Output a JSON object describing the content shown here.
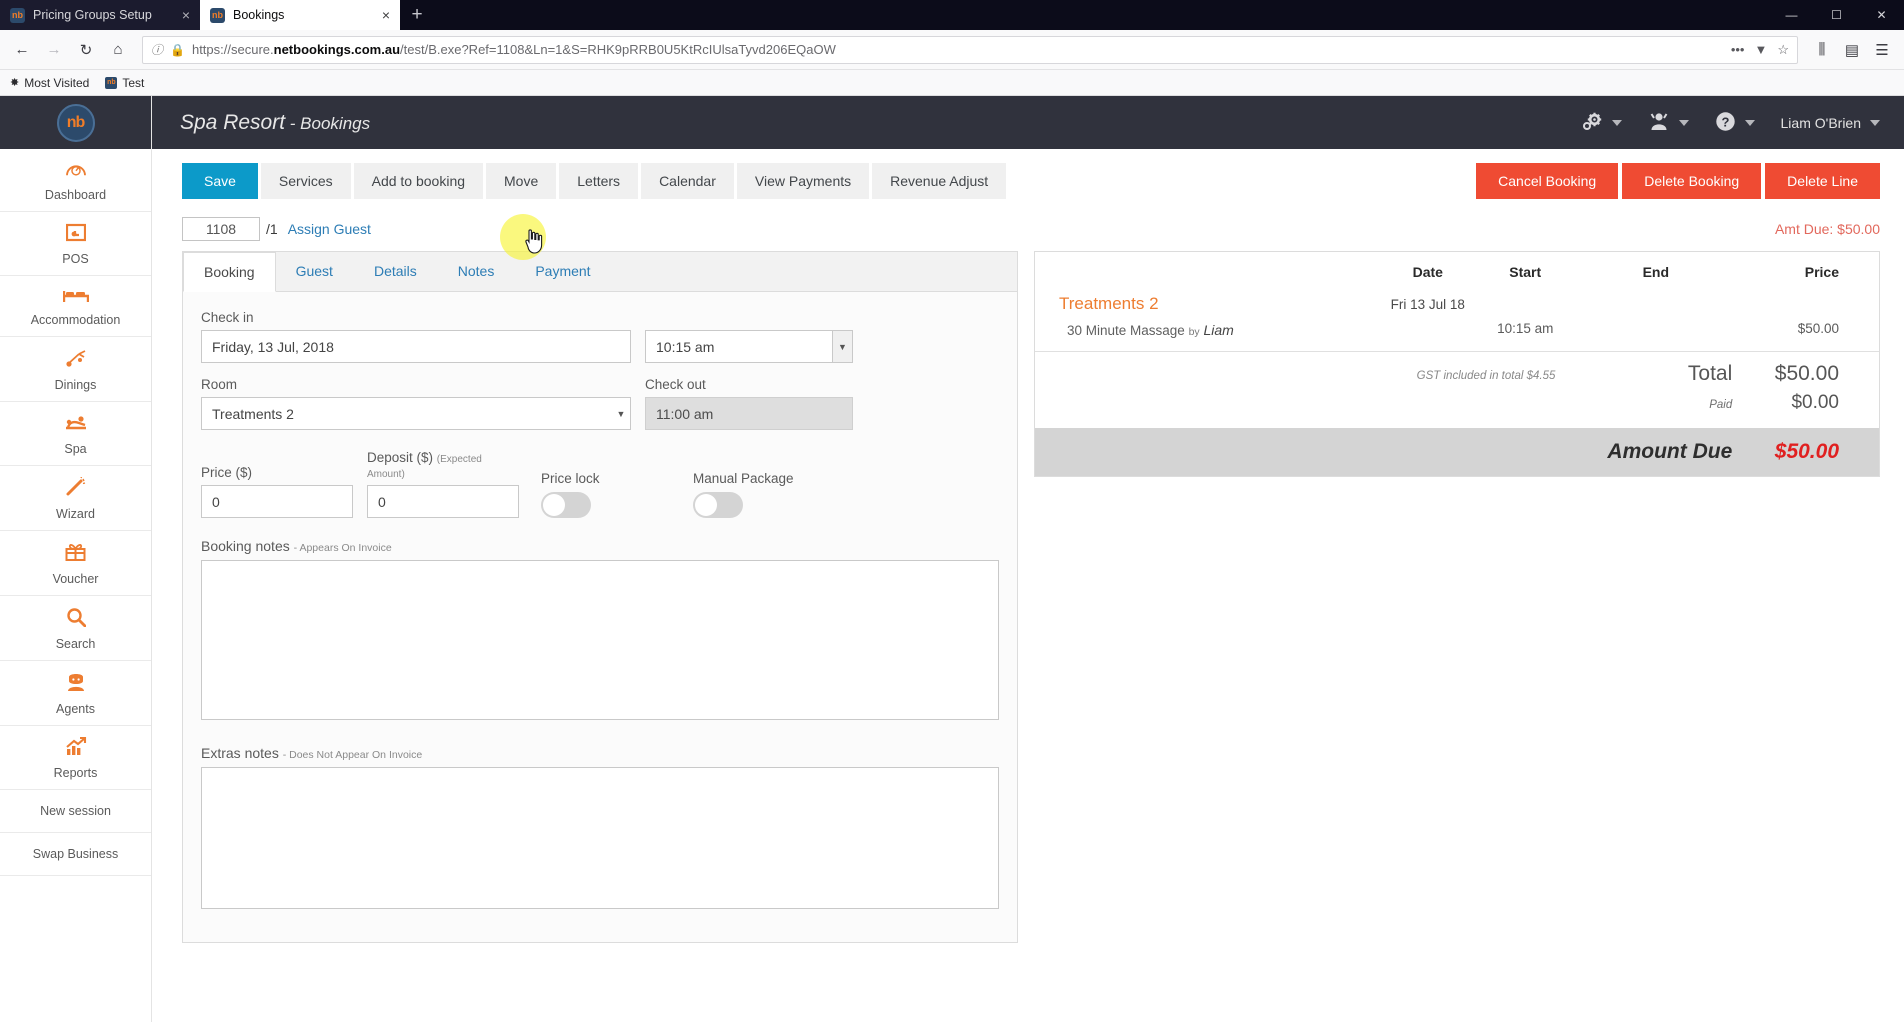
{
  "browser": {
    "tabs": [
      {
        "title": "Pricing Groups Setup",
        "favicon": "nb",
        "close": "×",
        "active": false
      },
      {
        "title": "Bookings",
        "favicon": "nb",
        "close": "×",
        "active": true
      }
    ],
    "new_tab_label": "+",
    "window_controls": {
      "minimize": "—",
      "maximize": "☐",
      "close": "✕"
    },
    "nav": {
      "back": "←",
      "forward": "→",
      "reload": "↻",
      "home": "⌂"
    },
    "url": {
      "scheme": "https://secure.",
      "domain": "netbookings.com.au",
      "path": "/test/B.exe?Ref=1108&Ln=1&S=RHK9pRRB0U5KtRcIUlsaTyvd206EQaOW",
      "full": "https://secure.netbookings.com.au/test/B.exe?Ref=1108&Ln=1&S=RHK9pRRB0U5KtRcIUlsaTyvd206EQaOW",
      "info_icon": "ⓘ",
      "lock_icon": "🔒",
      "page_actions": "•••",
      "pocket_icon": "▼",
      "bookmark_icon": "☆"
    },
    "toolbar_right": {
      "library": "⫼",
      "sidebars": "▤",
      "menu": "☰"
    },
    "bookmarks": [
      {
        "label": "Most Visited",
        "icon": "✸"
      },
      {
        "label": "Test",
        "icon": "nb"
      }
    ]
  },
  "sidebar": {
    "logo_text": "nb",
    "items": [
      {
        "label": "Dashboard",
        "icon": "◔",
        "icon_name": "dashboard-icon"
      },
      {
        "label": "POS",
        "icon": "▣",
        "icon_name": "pos-icon"
      },
      {
        "label": "Accommodation",
        "icon": "Ὤf",
        "icon_name": "bed-icon"
      },
      {
        "label": "Dinings",
        "icon": "♬",
        "icon_name": "cutlery-icon"
      },
      {
        "label": "Spa",
        "icon": "♨",
        "icon_name": "massage-icon"
      },
      {
        "label": "Wizard",
        "icon": "✦",
        "icon_name": "magic-wand-icon"
      },
      {
        "label": "Voucher",
        "icon": "❀",
        "icon_name": "gift-icon"
      },
      {
        "label": "Search",
        "icon": "⚲",
        "icon_name": "search-icon"
      },
      {
        "label": "Agents",
        "icon": "♟",
        "icon_name": "agent-icon"
      },
      {
        "label": "Reports",
        "icon": "↗",
        "icon_name": "reports-chart-icon"
      }
    ],
    "text_items": [
      {
        "label": "New session"
      },
      {
        "label": "Swap Business"
      }
    ]
  },
  "header": {
    "business_name": "Spa Resort",
    "separator": " - ",
    "section": "Bookings",
    "settings_icon": "⚙",
    "user_icon": "♟",
    "help_icon": "?",
    "account_name": "Liam O'Brien"
  },
  "toolbar": {
    "buttons": [
      {
        "label": "Save",
        "primary": true
      },
      {
        "label": "Services",
        "primary": false
      },
      {
        "label": "Add to booking",
        "primary": false
      },
      {
        "label": "Move",
        "primary": false
      },
      {
        "label": "Letters",
        "primary": false
      },
      {
        "label": "Calendar",
        "primary": false
      },
      {
        "label": "View Payments",
        "primary": false
      },
      {
        "label": "Revenue Adjust",
        "primary": false
      }
    ],
    "danger_buttons": [
      {
        "label": "Cancel Booking"
      },
      {
        "label": "Delete Booking"
      },
      {
        "label": "Delete Line"
      }
    ]
  },
  "ref_row": {
    "booking_ref": "1108",
    "line_suffix": "/1",
    "assign_guest_label": "Assign Guest",
    "amount_due_label": "Amt Due: $50.00"
  },
  "booking_form": {
    "tabs": [
      {
        "label": "Booking",
        "active": true
      },
      {
        "label": "Guest",
        "active": false
      },
      {
        "label": "Details",
        "active": false
      },
      {
        "label": "Notes",
        "active": false
      },
      {
        "label": "Payment",
        "active": false
      }
    ],
    "check_in_label": "Check in",
    "check_in_date": "Friday, 13 Jul, 2018",
    "check_in_time": "10:15 am",
    "room_label": "Room",
    "room_value": "Treatments 2",
    "check_out_label": "Check out",
    "check_out_time": "11:00 am",
    "price_label": "Price ($)",
    "price_value": "0",
    "deposit_label": "Deposit ($)",
    "deposit_hint": "(Expected Amount)",
    "deposit_value": "0",
    "price_lock_label": "Price lock",
    "price_lock_on": false,
    "manual_package_label": "Manual Package",
    "manual_package_on": false,
    "booking_notes_label": "Booking notes",
    "booking_notes_sub": "- Appears On Invoice",
    "booking_notes_value": "",
    "extras_notes_label": "Extras notes",
    "extras_notes_sub": "- Does Not Appear On Invoice",
    "extras_notes_value": ""
  },
  "summary": {
    "columns": {
      "item": "",
      "date": "Date",
      "start": "Start",
      "end": "End",
      "price": "Price"
    },
    "group_name": "Treatments 2",
    "group_date": "Fri 13 Jul 18",
    "line": {
      "name": "30 Minute Massage",
      "by_word": "by",
      "staff": "Liam",
      "date": "",
      "start": "10:15 am",
      "end": "",
      "price": "$50.00"
    },
    "gst_note": "GST included in total $4.55",
    "total_label": "Total",
    "total_value": "$50.00",
    "paid_label": "Paid",
    "paid_value": "$0.00",
    "amount_due_label": "Amount Due",
    "amount_due_value": "$50.00"
  },
  "colors": {
    "brand_orange": "#ed7d31",
    "primary_blue": "#0c9ac9",
    "danger_red": "#ef4b33",
    "header_dark": "#30323d",
    "link_blue": "#2d7db5",
    "due_red": "#e02020"
  }
}
